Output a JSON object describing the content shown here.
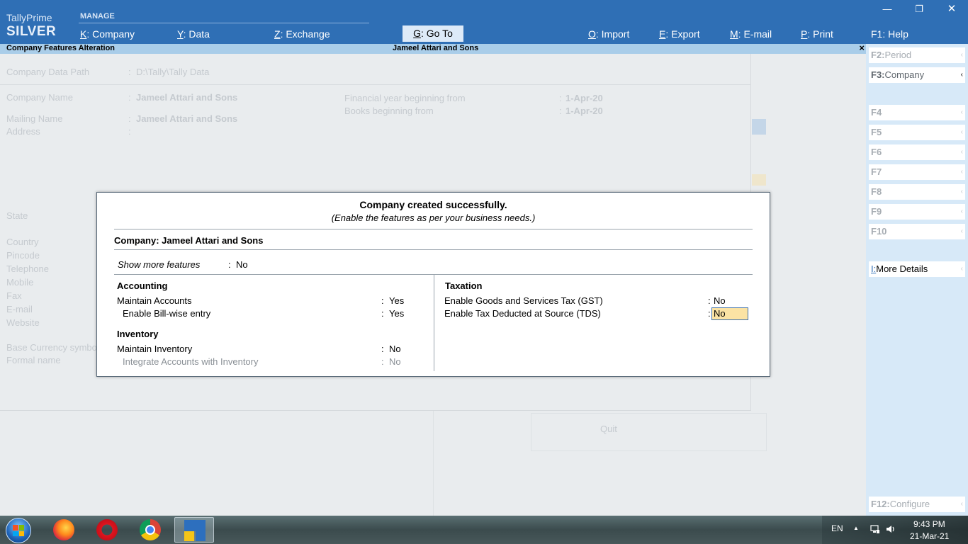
{
  "app": {
    "brand_name": "TallyPrime",
    "edition": "SILVER",
    "manage_label": "MANAGE"
  },
  "menu": {
    "company": {
      "key": "K",
      "label": "Company"
    },
    "data": {
      "key": "Y",
      "label": "Data"
    },
    "exchange": {
      "key": "Z",
      "label": "Exchange"
    },
    "goto": {
      "key": "G",
      "label": "Go To"
    },
    "import": {
      "key": "O",
      "label": "Import"
    },
    "export": {
      "key": "E",
      "label": "Export"
    },
    "email": {
      "key": "M",
      "label": "E-mail"
    },
    "print": {
      "key": "P",
      "label": "Print"
    },
    "help": {
      "key": "F1",
      "label": "Help"
    }
  },
  "window_controls": {
    "minimize": "—",
    "restore": "❐",
    "close": "✕"
  },
  "title_strip": {
    "left": "Company Features  Alteration",
    "center": "Jameel Attari and Sons",
    "close": "×"
  },
  "background_form": {
    "data_path_label": "Company Data Path",
    "data_path_value": "D:\\Tally\\Tally Data",
    "company_name_label": "Company Name",
    "company_name_value": "Jameel Attari and Sons",
    "mailing_name_label": "Mailing Name",
    "mailing_name_value": "Jameel Attari and Sons",
    "address_label": "Address",
    "fy_label": "Financial year beginning from",
    "fy_value": "1-Apr-20",
    "books_label": "Books beginning from",
    "books_value": "1-Apr-20",
    "state_label": "State",
    "country_label": "Country",
    "pincode_label": "Pincode",
    "telephone_label": "Telephone",
    "mobile_label": "Mobile",
    "fax_label": "Fax",
    "email_label": "E-mail",
    "website_label": "Website",
    "base_currency_label": "Base Currency symbol",
    "formal_name_label": "Formal name",
    "quit_label": "Quit",
    "separator": ":"
  },
  "sidebar": {
    "period": {
      "key": "F2:",
      "label": "Period"
    },
    "company": {
      "key": "F3:",
      "label": "Company"
    },
    "f4": "F4",
    "f5": "F5",
    "f6": "F6",
    "f7": "F7",
    "f8": "F8",
    "f9": "F9",
    "f10": "F10",
    "more_details": {
      "key": "I:",
      "label": "More Details"
    },
    "configure": {
      "key": "F12:",
      "label": "Configure"
    },
    "chevron": "‹"
  },
  "dialog": {
    "title": "Company created successfully.",
    "subtitle": "(Enable the features as per your business needs.)",
    "company_line": "Company: Jameel Attari and Sons",
    "show_more_label": "Show more features",
    "show_more_value": "No",
    "separator": ":",
    "accounting": {
      "heading": "Accounting",
      "maintain_accounts_label": "Maintain Accounts",
      "maintain_accounts_value": "Yes",
      "bill_wise_label": "Enable Bill-wise entry",
      "bill_wise_value": "Yes"
    },
    "inventory": {
      "heading": "Inventory",
      "maintain_inventory_label": "Maintain Inventory",
      "maintain_inventory_value": "No",
      "integrate_label": "Integrate Accounts with Inventory",
      "integrate_value": "No"
    },
    "taxation": {
      "heading": "Taxation",
      "gst_label": "Enable Goods and Services Tax (GST)",
      "gst_value": "No",
      "tds_label": "Enable Tax Deducted at Source (TDS)",
      "tds_value": "No"
    }
  },
  "taskbar": {
    "language": "EN",
    "time": "9:43 PM",
    "date": "21-Mar-21",
    "tray_arrow": "▲"
  },
  "icons": {
    "start": "windows-start-icon",
    "firefox": "firefox-icon",
    "opera": "opera-icon",
    "chrome": "chrome-icon",
    "tally": "tallyprime-icon"
  },
  "colors": {
    "topbar": "#2f6fb5",
    "title_strip": "#a9cde9",
    "sidebar": "#d7e9f8",
    "active_field": "#fbe3a4"
  }
}
